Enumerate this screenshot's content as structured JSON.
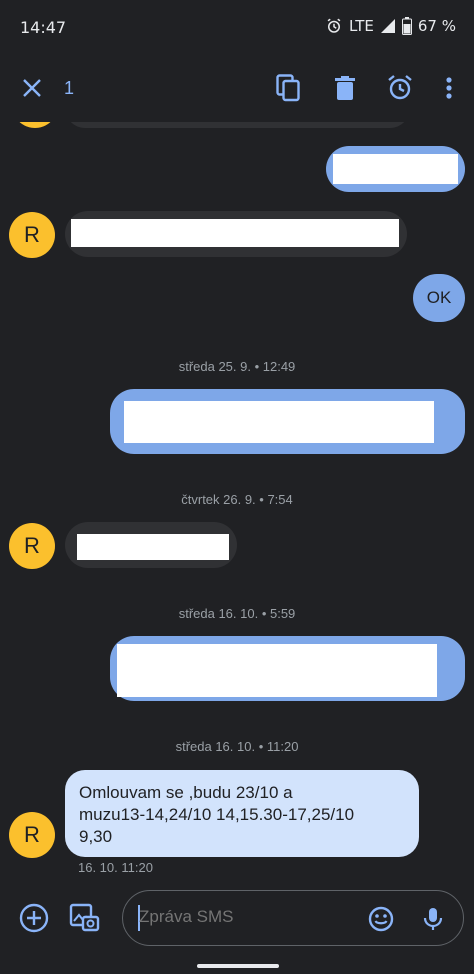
{
  "status_bar": {
    "time": "14:47",
    "network": "LTE",
    "battery": "67 %"
  },
  "action_bar": {
    "selected_count": "1",
    "icons": [
      "close-icon",
      "copy-icon",
      "delete-icon",
      "alarm-icon",
      "more-vert-icon"
    ]
  },
  "contact_initial": "R",
  "messages": {
    "ok_reply": "OK",
    "timestamps": {
      "t1": "středa 25. 9. • 12:49",
      "t2": "čtvrtek 26. 9. • 7:54",
      "t3": "středa 16. 10. • 5:59",
      "t4": "středa 16. 10. • 11:20"
    },
    "last_message": {
      "line1": "Omlouvam se ,budu 23/10 a",
      "line2": "muzu13-14,24/10 14,15.30-17,25/10",
      "line3": "9,30",
      "time": "16. 10. 11:20"
    }
  },
  "compose": {
    "placeholder": "Zpráva SMS"
  },
  "colors": {
    "background": "#202124",
    "outgoing_bubble": "#7ea7e8",
    "incoming_bubble": "#303134",
    "selected_bubble": "#d2e3fc",
    "accent": "#8ab4f8",
    "avatar": "#fbc02d"
  }
}
